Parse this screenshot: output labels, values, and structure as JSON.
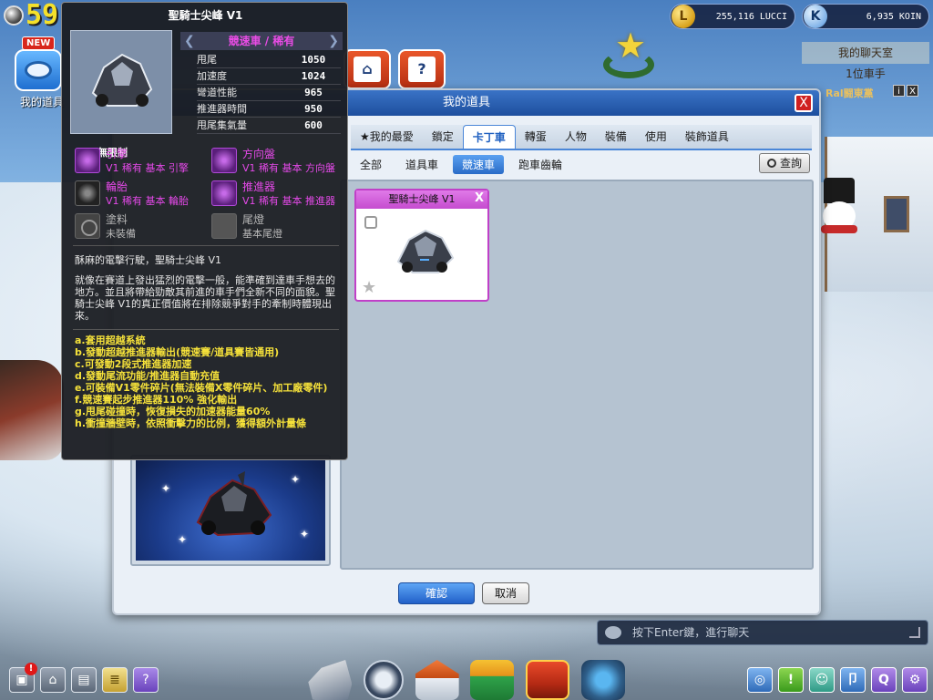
{
  "hud": {
    "level": "59",
    "new_badge": "NEW",
    "items_label": "我的道具",
    "lucci": "255,116 LUCCI",
    "koin": "6,935 KOIN",
    "lucci_symbol": "L",
    "koin_symbol": "K",
    "chatroom": "我的聊天室",
    "rank": "1位車手",
    "user_name": "Ral闘東黨",
    "info_btn": "i",
    "close_btn": "X"
  },
  "dialog": {
    "title": "我的道具",
    "close": "X",
    "tabs": [
      {
        "label": "★我的最愛"
      },
      {
        "label": "鎖定"
      },
      {
        "label": "卡丁車"
      },
      {
        "label": "轉蛋"
      },
      {
        "label": "人物"
      },
      {
        "label": "裝備"
      },
      {
        "label": "使用"
      },
      {
        "label": "裝飾道具"
      }
    ],
    "subtabs": [
      {
        "label": "全部"
      },
      {
        "label": "道具車"
      },
      {
        "label": "競速車"
      },
      {
        "label": "跑車齒輪"
      }
    ],
    "search_label": "查詢",
    "item": {
      "name": "聖騎士尖峰 V1",
      "close": "X",
      "star": "★"
    },
    "confirm": "確認",
    "cancel": "取消"
  },
  "tooltip": {
    "title": "聖騎士尖峰 V1",
    "unlimited": "無限制",
    "category": "競速車 / 稀有",
    "stats": [
      {
        "label": "甩尾",
        "value": "1050"
      },
      {
        "label": "加速度",
        "value": "1024"
      },
      {
        "label": "彎道性能",
        "value": "965"
      },
      {
        "label": "推進器時間",
        "value": "950"
      },
      {
        "label": "甩尾集氣量",
        "value": "600"
      }
    ],
    "parts": [
      {
        "name": "引擎",
        "desc": "V1 稀有 基本 引擎"
      },
      {
        "name": "方向盤",
        "desc": "V1 稀有 基本 方向盤"
      },
      {
        "name": "輪胎",
        "desc": "V1 稀有 基本 輪胎"
      },
      {
        "name": "推進器",
        "desc": "V1 稀有 基本 推進器"
      },
      {
        "name": "塗料",
        "desc": "未裝備"
      },
      {
        "name": "尾燈",
        "desc": "基本尾燈"
      }
    ],
    "flavor": "酥麻的電擊行駛，聖騎士尖峰 V1",
    "description": "就像在賽道上發出猛烈的電擊一般，能準確到達車手想去的地方。並且將帶給勁敵其前進的車手們全新不同的面貌。聖騎士尖峰 V1的真正價值將在排除競爭對手的牽制時體現出來。",
    "features": [
      "a.套用超越系統",
      "b.發動超越推進器輸出(競速賽/道具賽皆通用)",
      "c.可發動2段式推進器加速",
      "d.發動尾流功能/推進器自動充值",
      "e.可裝備V1零件碎片(無法裝備X零件碎片、加工廠零件)",
      "f.競速賽起步推進器110% 強化輸出",
      "g.甩尾碰撞時，恢復損失的加速器能量60%",
      "h.衝撞牆壁時，依照衝擊力的比例，獲得額外計量條"
    ]
  },
  "chat": {
    "placeholder": "按下Enter鍵，進行聊天"
  },
  "bottom": {
    "alert": "!",
    "right_icons": [
      "◎",
      "!",
      "☺",
      "卩",
      "Q",
      "⚙"
    ]
  }
}
